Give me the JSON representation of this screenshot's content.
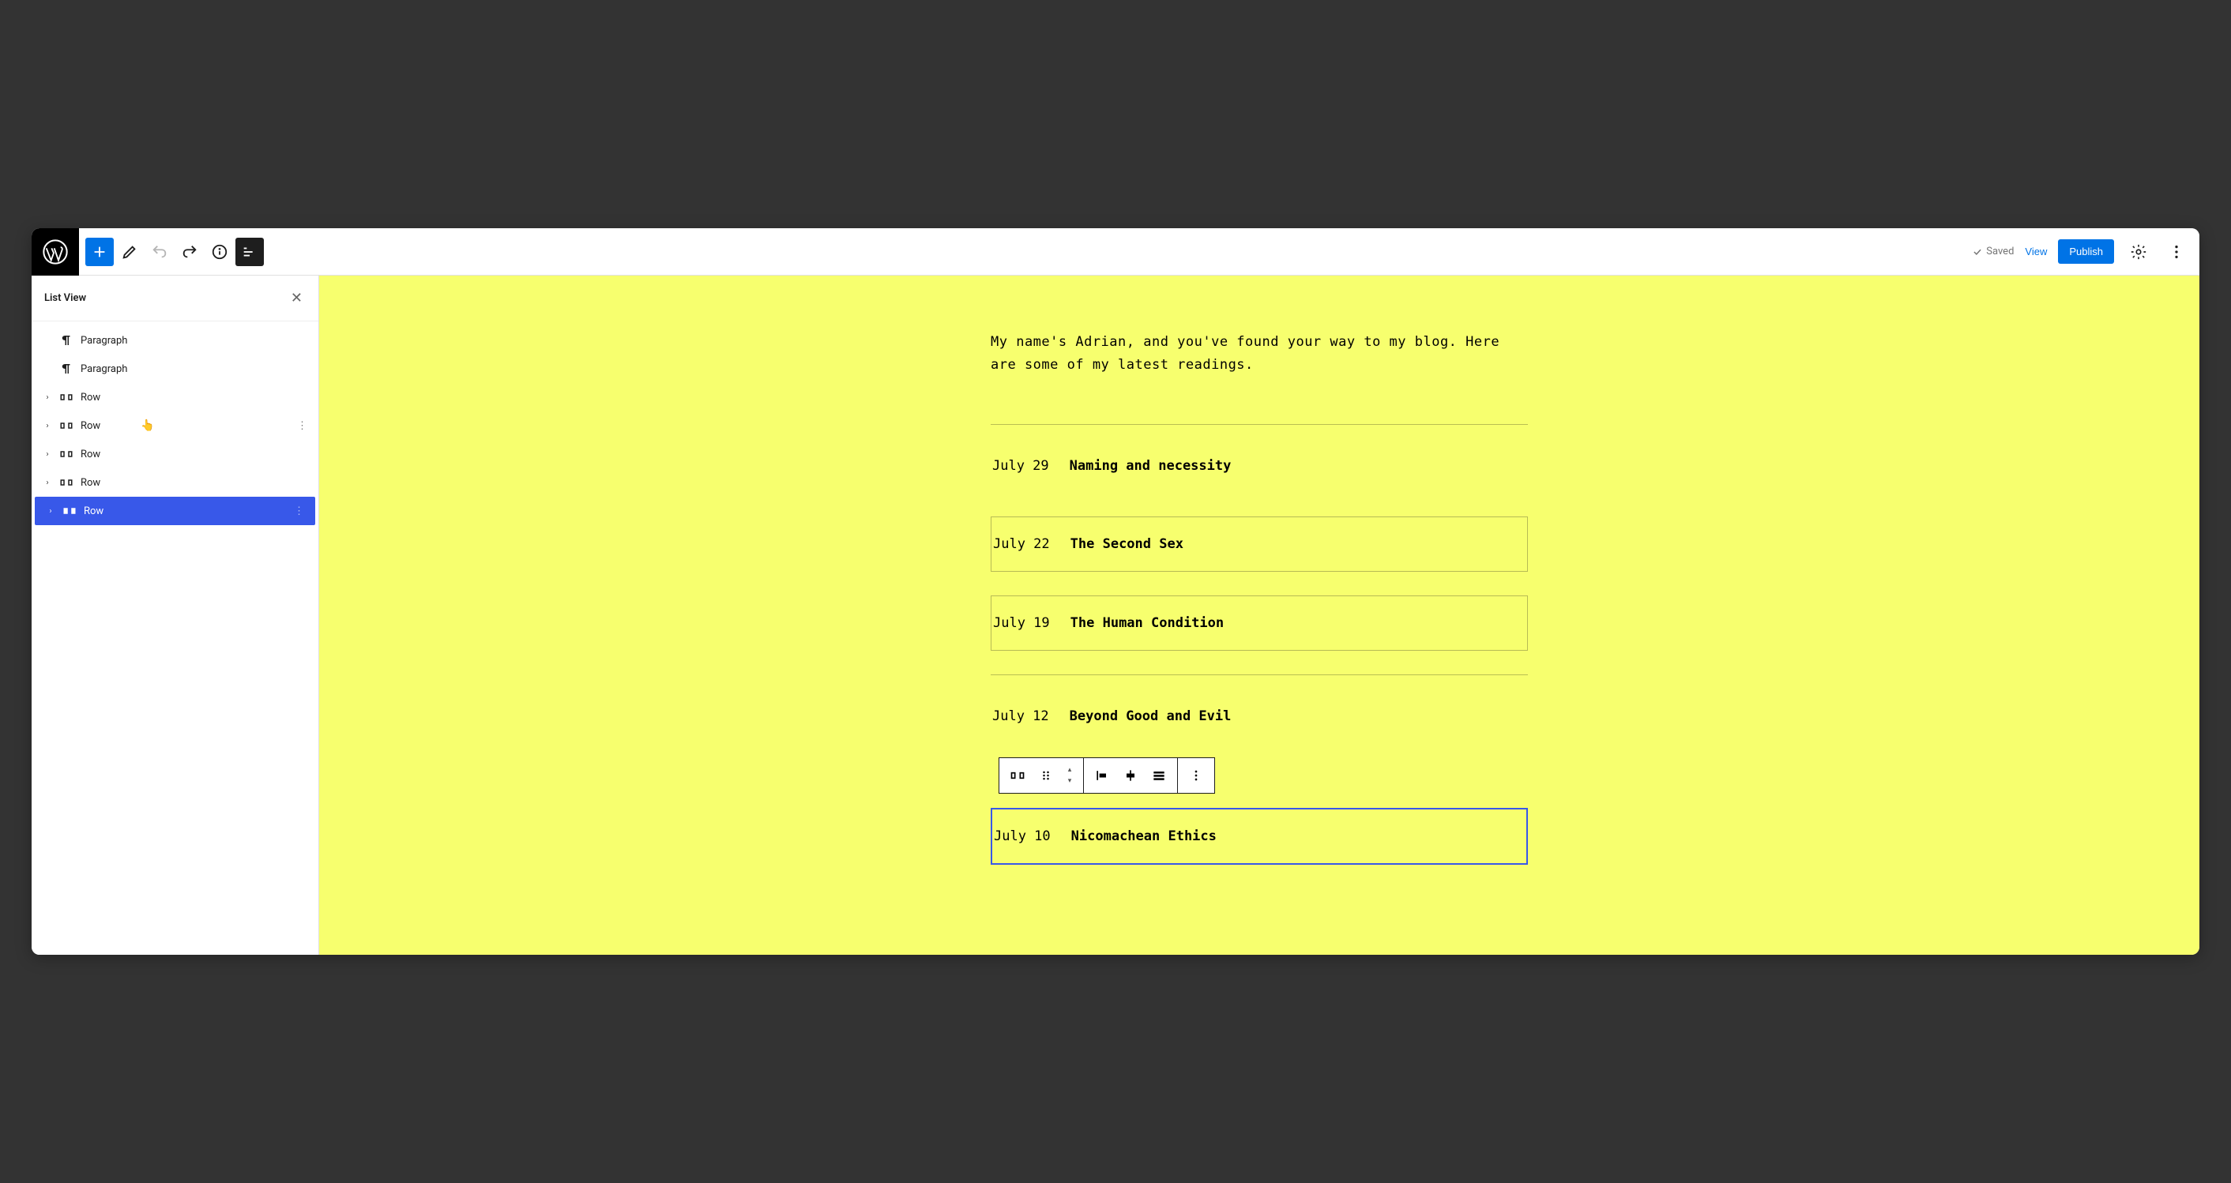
{
  "topbar": {
    "saved_label": "Saved",
    "view_label": "View",
    "publish_label": "Publish"
  },
  "sidebar": {
    "title": "List View",
    "items": [
      {
        "type": "paragraph",
        "label": "Paragraph",
        "expandable": false,
        "selected": false,
        "hover": false
      },
      {
        "type": "paragraph",
        "label": "Paragraph",
        "expandable": false,
        "selected": false,
        "hover": false
      },
      {
        "type": "row",
        "label": "Row",
        "expandable": true,
        "selected": false,
        "hover": false
      },
      {
        "type": "row",
        "label": "Row",
        "expandable": true,
        "selected": false,
        "hover": true
      },
      {
        "type": "row",
        "label": "Row",
        "expandable": true,
        "selected": false,
        "hover": false
      },
      {
        "type": "row",
        "label": "Row",
        "expandable": true,
        "selected": false,
        "hover": false
      },
      {
        "type": "row",
        "label": "Row",
        "expandable": true,
        "selected": true,
        "hover": false
      }
    ]
  },
  "content": {
    "intro": "My name's Adrian, and you've found your way to my blog. Here are some of my latest readings.",
    "entries": [
      {
        "date": "July 29",
        "title": "Naming and necessity",
        "boxed": false,
        "selected": false
      },
      {
        "date": "July 22",
        "title": "The Second Sex",
        "boxed": true,
        "selected": false
      },
      {
        "date": "July 19",
        "title": "The Human Condition",
        "boxed": true,
        "selected": false
      },
      {
        "date": "July 12",
        "title": "Beyond Good and Evil",
        "boxed": false,
        "selected": false
      },
      {
        "date": "July 10",
        "title": "Nicomachean Ethics",
        "boxed": false,
        "selected": true
      }
    ]
  }
}
